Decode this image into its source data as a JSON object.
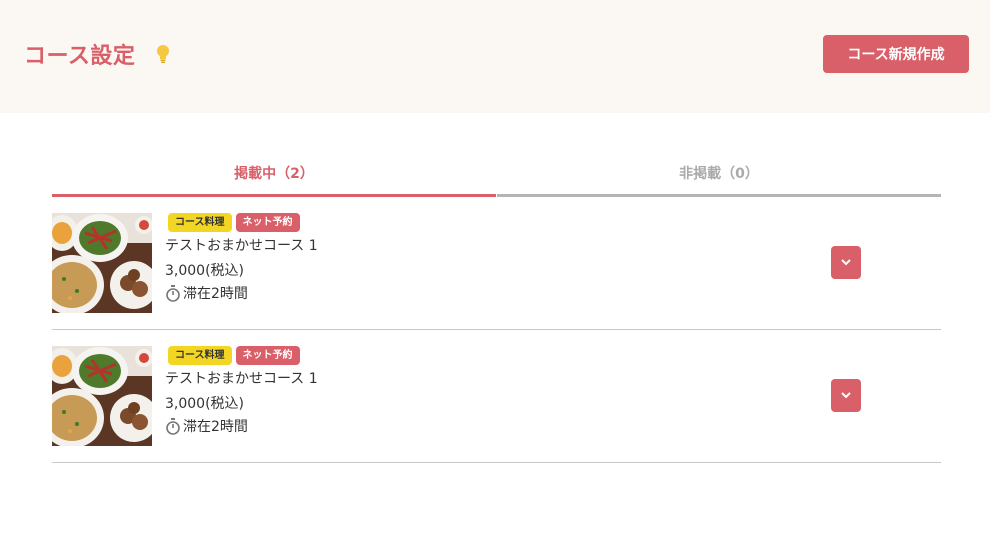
{
  "header": {
    "title": "コース設定",
    "new_course_button": "コース新規作成"
  },
  "tabs": [
    {
      "label": "掲載中（2）",
      "active": true
    },
    {
      "label": "非掲載（0）",
      "active": false
    }
  ],
  "courses": [
    {
      "badges": [
        "コース料理",
        "ネット予約"
      ],
      "name": "テストおまかせコース 1",
      "price": "3,000(税込)",
      "stay": "滞在2時間"
    },
    {
      "badges": [
        "コース料理",
        "ネット予約"
      ],
      "name": "テストおまかせコース 1",
      "price": "3,000(税込)",
      "stay": "滞在2時間"
    }
  ],
  "colors": {
    "accent": "#d95f69",
    "header_bg": "#fbf7f3",
    "badge_yellow": "#f3d623",
    "bulb": "#f5c842"
  },
  "icons": [
    "lightbulb-icon",
    "timer-icon",
    "chevron-down-icon"
  ]
}
